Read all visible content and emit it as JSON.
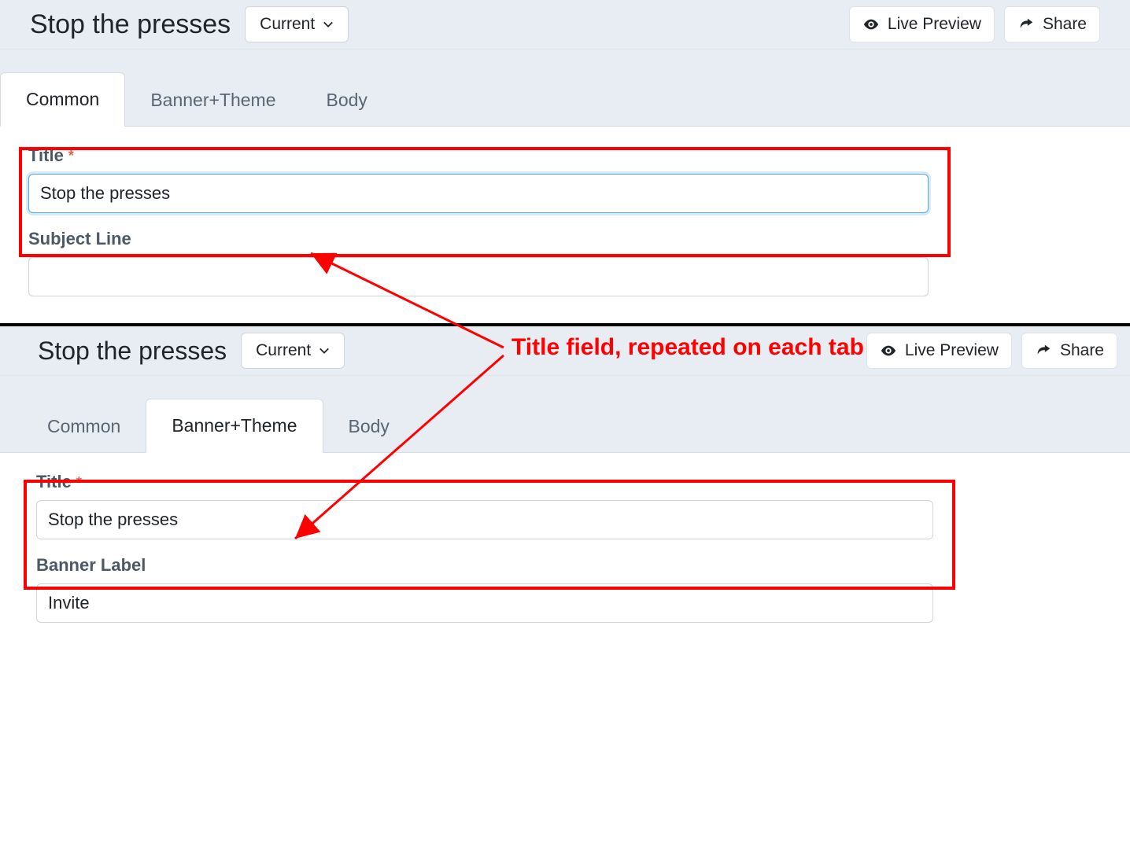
{
  "panels": [
    {
      "title": "Stop the presses",
      "dropdown_label": "Current",
      "actions": {
        "preview": "Live Preview",
        "share": "Share"
      },
      "tabs": [
        "Common",
        "Banner+Theme",
        "Body"
      ],
      "active_tab": 0,
      "fields": {
        "title_label": "Title",
        "title_value": "Stop the presses",
        "second_label": "Subject Line",
        "second_value": ""
      },
      "title_focused": true
    },
    {
      "title": "Stop the presses",
      "dropdown_label": "Current",
      "actions": {
        "preview": "Live Preview",
        "share": "Share"
      },
      "tabs": [
        "Common",
        "Banner+Theme",
        "Body"
      ],
      "active_tab": 1,
      "fields": {
        "title_label": "Title",
        "title_value": "Stop the presses",
        "second_label": "Banner Label",
        "second_value": "Invite"
      },
      "title_focused": false
    }
  ],
  "annotation": "Title field, repeated on each tab",
  "colors": {
    "highlight": "#ff0000",
    "header_bg": "#e7edf3"
  }
}
